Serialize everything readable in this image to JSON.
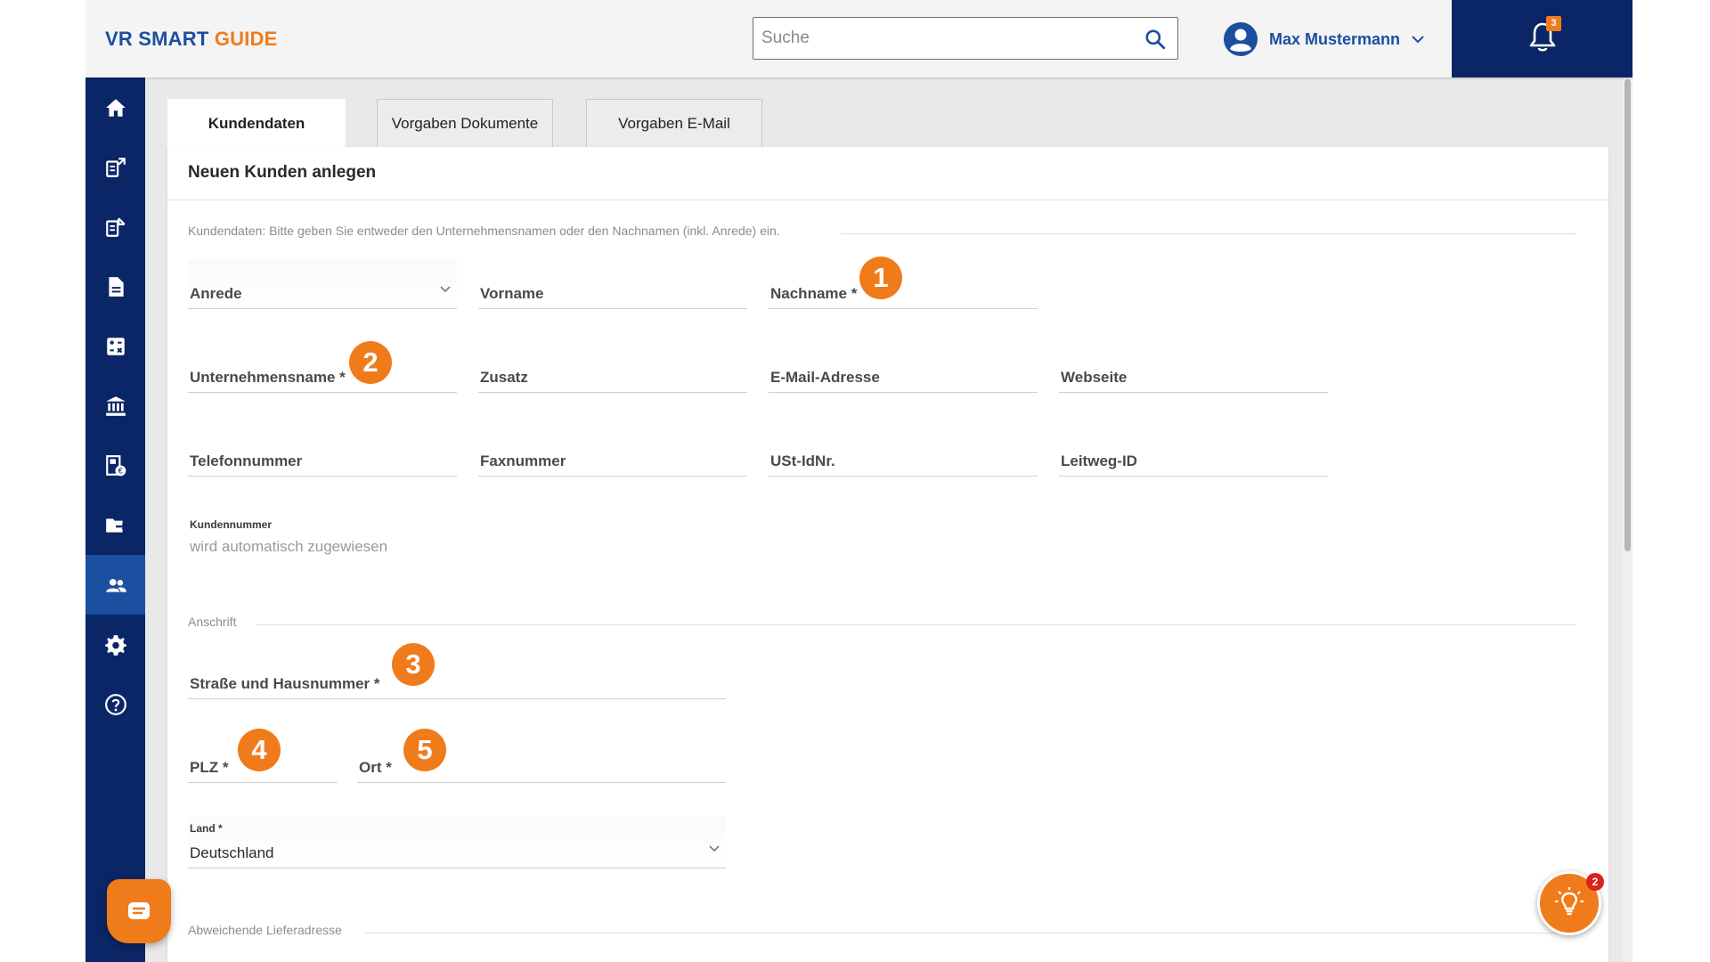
{
  "header": {
    "logo_part1": "VR SMART ",
    "logo_part2": "GUIDE",
    "search_placeholder": "Suche",
    "user_name": "Max Mustermann",
    "notification_count": "3"
  },
  "sidebar": {
    "items": [
      {
        "icon": "home-icon"
      },
      {
        "icon": "outgoing-invoice-icon"
      },
      {
        "icon": "incoming-invoice-icon"
      },
      {
        "icon": "document-icon"
      },
      {
        "icon": "calculator-icon"
      },
      {
        "icon": "bank-icon"
      },
      {
        "icon": "receipt-euro-icon"
      },
      {
        "icon": "folder-export-icon"
      },
      {
        "icon": "customers-icon",
        "active": true
      },
      {
        "icon": "settings-gear-icon"
      },
      {
        "icon": "help-icon"
      }
    ]
  },
  "tabs": [
    "Kundendaten",
    "Vorgaben Dokumente",
    "Vorgaben E-Mail"
  ],
  "form": {
    "title": "Neuen Kunden anlegen",
    "section_customer": "Kundendaten: Bitte geben Sie entweder den Unternehmensnamen oder den Nachnamen (inkl. Anrede) ein.",
    "fields": {
      "anrede": "Anrede",
      "vorname": "Vorname",
      "nachname": "Nachname *",
      "unternehmensname": "Unternehmensname *",
      "zusatz": "Zusatz",
      "email": "E-Mail-Adresse",
      "webseite": "Webseite",
      "telefon": "Telefonnummer",
      "fax": "Faxnummer",
      "ustid": "USt-IdNr.",
      "leitweg": "Leitweg-ID",
      "strasse": "Straße und Hausnummer *",
      "plz": "PLZ *",
      "ort": "Ort *"
    },
    "kundennummer_label": "Kundennummer",
    "kundennummer_value": "wird automatisch zugewiesen",
    "section_address": "Anschrift",
    "land_label": "Land *",
    "land_value": "Deutschland",
    "section_delivery": "Abweichende Lieferadresse"
  },
  "markers": [
    "1",
    "2",
    "3",
    "4",
    "5"
  ],
  "tips_badge": "2",
  "colors": {
    "brand_blue": "#1b4fa0",
    "navy": "#0b2666",
    "accent_orange": "#f07b1b"
  }
}
